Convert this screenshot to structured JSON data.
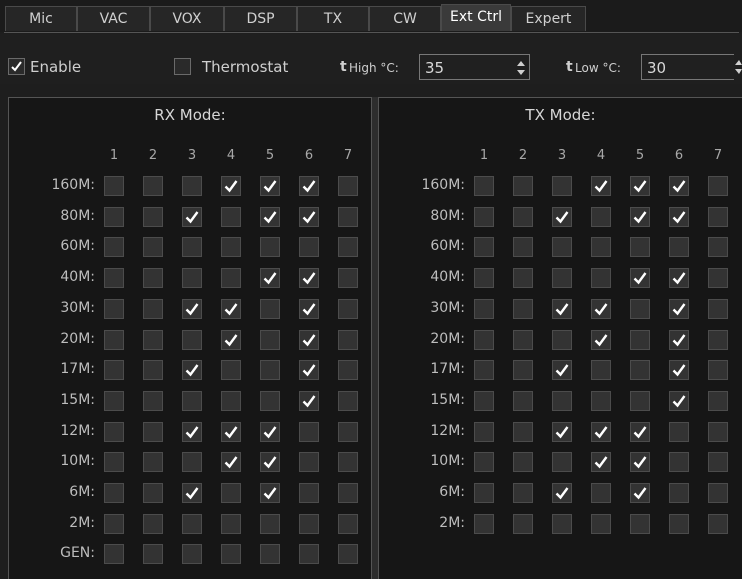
{
  "tabs": [
    {
      "label": "Mic",
      "active": false
    },
    {
      "label": "VAC",
      "active": false
    },
    {
      "label": "VOX",
      "active": false
    },
    {
      "label": "DSP",
      "active": false
    },
    {
      "label": "TX",
      "active": false
    },
    {
      "label": "CW",
      "active": false
    },
    {
      "label": "Ext Ctrl",
      "active": true
    },
    {
      "label": "Expert",
      "active": false
    }
  ],
  "toolbar": {
    "enable": {
      "label": "Enable",
      "checked": true
    },
    "thermostat": {
      "label": "Thermostat",
      "checked": false
    },
    "t_high": {
      "prefix": "t",
      "label": "High °C:",
      "value": "35"
    },
    "t_low": {
      "prefix": "t",
      "label": "Low °C:",
      "value": "30"
    }
  },
  "columns": [
    "1",
    "2",
    "3",
    "4",
    "5",
    "6",
    "7"
  ],
  "rx": {
    "title": "RX Mode:",
    "rows": [
      {
        "band": "160M:",
        "checks": [
          0,
          0,
          0,
          1,
          1,
          1,
          0
        ]
      },
      {
        "band": "80M:",
        "checks": [
          0,
          0,
          1,
          0,
          1,
          1,
          0
        ]
      },
      {
        "band": "60M:",
        "checks": [
          0,
          0,
          0,
          0,
          0,
          0,
          0
        ]
      },
      {
        "band": "40M:",
        "checks": [
          0,
          0,
          0,
          0,
          1,
          1,
          0
        ]
      },
      {
        "band": "30M:",
        "checks": [
          0,
          0,
          1,
          1,
          0,
          1,
          0
        ]
      },
      {
        "band": "20M:",
        "checks": [
          0,
          0,
          0,
          1,
          0,
          1,
          0
        ]
      },
      {
        "band": "17M:",
        "checks": [
          0,
          0,
          1,
          0,
          0,
          1,
          0
        ]
      },
      {
        "band": "15M:",
        "checks": [
          0,
          0,
          0,
          0,
          0,
          1,
          0
        ]
      },
      {
        "band": "12M:",
        "checks": [
          0,
          0,
          1,
          1,
          1,
          0,
          0
        ]
      },
      {
        "band": "10M:",
        "checks": [
          0,
          0,
          0,
          1,
          1,
          0,
          0
        ]
      },
      {
        "band": "6M:",
        "checks": [
          0,
          0,
          1,
          0,
          1,
          0,
          0
        ]
      },
      {
        "band": "2M:",
        "checks": [
          0,
          0,
          0,
          0,
          0,
          0,
          0
        ]
      },
      {
        "band": "GEN:",
        "checks": [
          0,
          0,
          0,
          0,
          0,
          0,
          0
        ]
      }
    ]
  },
  "tx": {
    "title": "TX Mode:",
    "rows": [
      {
        "band": "160M:",
        "checks": [
          0,
          0,
          0,
          1,
          1,
          1,
          0
        ]
      },
      {
        "band": "80M:",
        "checks": [
          0,
          0,
          1,
          0,
          1,
          1,
          0
        ]
      },
      {
        "band": "60M:",
        "checks": [
          0,
          0,
          0,
          0,
          0,
          0,
          0
        ]
      },
      {
        "band": "40M:",
        "checks": [
          0,
          0,
          0,
          0,
          1,
          1,
          0
        ]
      },
      {
        "band": "30M:",
        "checks": [
          0,
          0,
          1,
          1,
          0,
          1,
          0
        ]
      },
      {
        "band": "20M:",
        "checks": [
          0,
          0,
          0,
          1,
          0,
          1,
          0
        ]
      },
      {
        "band": "17M:",
        "checks": [
          0,
          0,
          1,
          0,
          0,
          1,
          0
        ]
      },
      {
        "band": "15M:",
        "checks": [
          0,
          0,
          0,
          0,
          0,
          1,
          0
        ]
      },
      {
        "band": "12M:",
        "checks": [
          0,
          0,
          1,
          1,
          1,
          0,
          0
        ]
      },
      {
        "band": "10M:",
        "checks": [
          0,
          0,
          0,
          1,
          1,
          0,
          0
        ]
      },
      {
        "band": "6M:",
        "checks": [
          0,
          0,
          1,
          0,
          1,
          0,
          0
        ]
      },
      {
        "band": "2M:",
        "checks": [
          0,
          0,
          0,
          0,
          0,
          0,
          0
        ]
      }
    ]
  }
}
